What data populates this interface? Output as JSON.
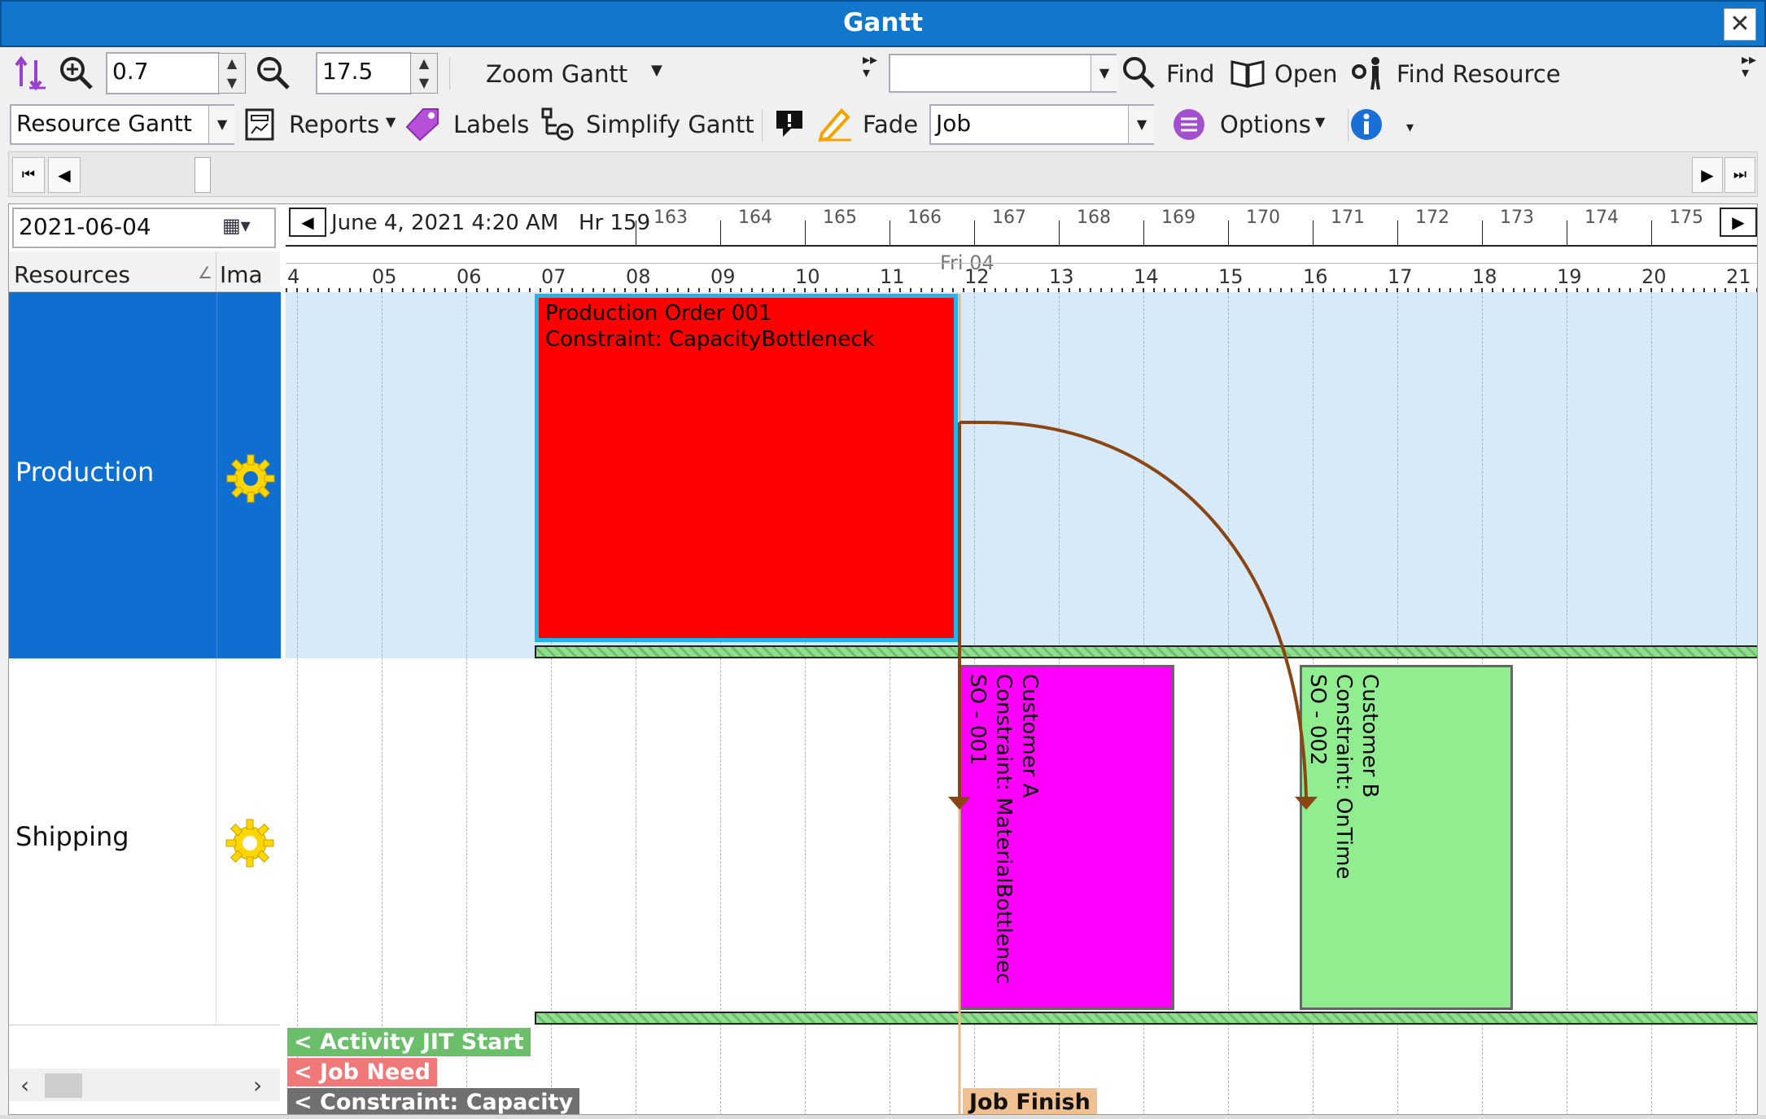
{
  "window": {
    "title": "Gantt",
    "close_label": "✕"
  },
  "toolbar1": {
    "zoom_in_value": "0.7",
    "zoom_out_value": "17.5",
    "zoom_gantt_label": "Zoom Gantt",
    "search_value": "",
    "find_label": "Find",
    "open_label": "Open",
    "find_resource_label": "Find Resource"
  },
  "toolbar2": {
    "view_select": "Resource Gantt",
    "reports_label": "Reports",
    "labels_label": "Labels",
    "simplify_label": "Simplify Gantt",
    "fade_label": "Fade",
    "fade_select": "Job",
    "options_label": "Options"
  },
  "date_field": "2021-06-04",
  "timeline": {
    "current_datetime": "June 4, 2021  4:20 AM",
    "hour_label": "Hr 159",
    "hour_ticks": [
      "163",
      "164",
      "165",
      "166",
      "167",
      "168",
      "169",
      "170",
      "171",
      "172",
      "173",
      "174",
      "175"
    ],
    "day_label": "Fri 04",
    "minor_ticks": [
      "4",
      "05",
      "06",
      "07",
      "08",
      "09",
      "10",
      "11",
      "12",
      "13",
      "14",
      "15",
      "16",
      "17",
      "18",
      "19",
      "20",
      "21"
    ]
  },
  "columns": {
    "resources": "Resources",
    "image": "Ima"
  },
  "resources": [
    {
      "name": "Production",
      "icon": "gear-icon"
    },
    {
      "name": "Shipping",
      "icon": "gear-icon"
    }
  ],
  "bars": {
    "production_order": {
      "line1": "Production Order 001",
      "line2": "Constraint: CapacityBottleneck",
      "color": "#ff0000"
    },
    "customer_a": {
      "line1": "Customer A",
      "line2": "Constraint: MaterialBottlenec",
      "line3": "SO - 001",
      "color": "#ff00ff"
    },
    "customer_b": {
      "line1": "Customer B",
      "line2": "Constraint: OnTime",
      "line3": "SO - 002",
      "color": "#90ee90"
    }
  },
  "legend": {
    "jit_start": "< Activity JIT Start",
    "job_need": "< Job Need",
    "constraint": "< Constraint: Capacity",
    "job_finish": "Job Finish"
  },
  "colors": {
    "title": "#1177cc",
    "selected_row": "#0f6fd0",
    "link": "#8b4513"
  }
}
